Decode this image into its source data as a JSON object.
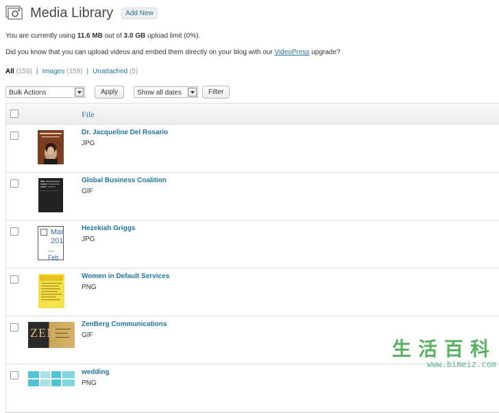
{
  "header": {
    "title": "Media Library",
    "add_new_label": "Add New",
    "icon": "media-camera-icon"
  },
  "usage": {
    "prefix": "You are currently using ",
    "used": "11.6 MB",
    "middle": " out of ",
    "limit": "3.0 GB",
    "suffix": " upload limit (0%)."
  },
  "upsell": {
    "text": "Did you know that you can upload videos and embed them directly on your blog with our ",
    "link": "VideoPress",
    "suffix": " upgrade?"
  },
  "filters": [
    {
      "label": "All",
      "count": "(159)"
    },
    {
      "label": "Images",
      "count": "(158)"
    },
    {
      "label": "Unattached",
      "count": "(5)"
    }
  ],
  "toolbar": {
    "bulk_actions": "Bulk Actions",
    "apply": "Apply",
    "dates": "Show all dates",
    "filter": "Filter"
  },
  "table": {
    "file_header": "File",
    "rows": [
      {
        "title": "Dr. Jacqueline Del Rosario",
        "type": "JPG"
      },
      {
        "title": "Global Business Coalition",
        "type": "GIF"
      },
      {
        "title": "Hezekiah Griggs",
        "type": "JPG"
      },
      {
        "title": "Women in Default Services",
        "type": "PNG"
      },
      {
        "title": "ZenBerg Communications",
        "type": "GIF"
      },
      {
        "title": "wedding",
        "type": "PNG"
      }
    ]
  },
  "thumbs": {
    "hezekiah_lines": [
      "Mar",
      "201",
      "— Feb"
    ],
    "zen_text": "ZEN"
  },
  "watermark": {
    "cn": "生活百科",
    "url": "www.bimeiz.com"
  },
  "colors": {
    "link": "#21759b",
    "header_gradient_top": "#f9f9f9",
    "header_gradient_bottom": "#ececec",
    "watermark_green": "#2e9e3c"
  }
}
